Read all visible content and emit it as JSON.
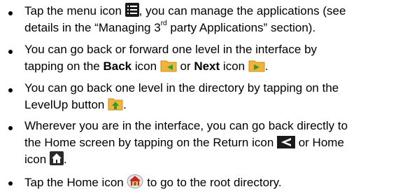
{
  "items": [
    {
      "line1_pre": "Tap the menu icon ",
      "menu_icon": "menu-icon",
      "line1_post": ", you can manage the applications (see",
      "line2_pre": "details in the “Managing 3",
      "line2_sup": "rd",
      "line2_post": " party Applications” section)."
    },
    {
      "line1": "You can go back or forward one level in the interface by",
      "line2_pre": "tapping on the ",
      "back_bold": "Back",
      "line2_mid1": " icon ",
      "back_icon": "folder-back-icon",
      "line2_mid2": " or ",
      "next_bold": "Next",
      "line2_mid3": " icon ",
      "next_icon": "folder-next-icon",
      "line2_end": "."
    },
    {
      "line1": "You can go back one level in the directory by tapping on the",
      "line2_pre": "LevelUp button ",
      "levelup_icon": "levelup-icon",
      "line2_end": "."
    },
    {
      "line1": "Wherever you are in the interface, you can go back directly to",
      "line2_pre": "the Home screen by tapping on the Return icon ",
      "return_icon": "return-arrow-icon",
      "line2_post": " or Home",
      "line3_pre": "icon ",
      "home_icon": "home-icon",
      "line3_end": "."
    },
    {
      "line1_pre": "Tap the Home icon ",
      "root_home_icon": "home-folder-icon",
      "line1_post": " to go to the root directory."
    }
  ],
  "colors": {
    "text": "#000000",
    "folder": "#f2b33a",
    "arrow_green": "#2e9e2e",
    "dark_icon": "#1a1a1a"
  }
}
